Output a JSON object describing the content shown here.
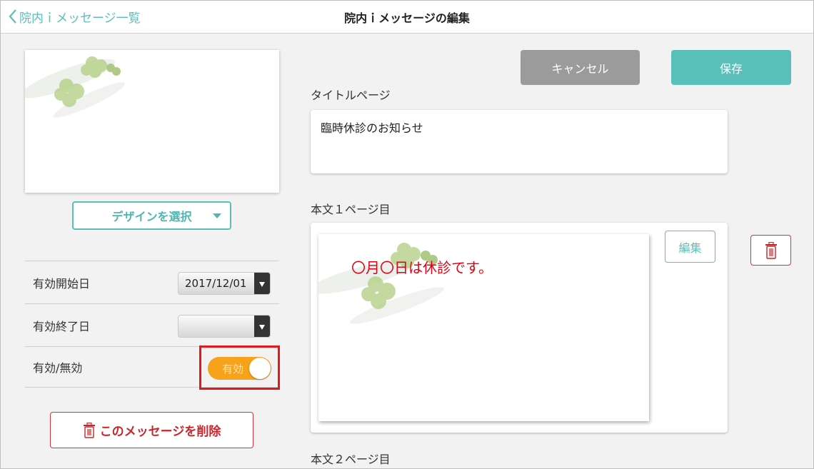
{
  "header": {
    "back_label": "院内ｉメッセージ一覧",
    "title": "院内ｉメッセージの編集"
  },
  "left": {
    "design_select_label": "デザインを選択",
    "settings": [
      {
        "label": "有効開始日",
        "value": "2017/12/01"
      },
      {
        "label": "有効終了日",
        "value": ""
      },
      {
        "label": "有効/無効",
        "toggle_text": "有効",
        "toggle_on": true
      }
    ],
    "delete_message_label": "このメッセージを削除"
  },
  "right": {
    "cancel_label": "キャンセル",
    "save_label": "保存",
    "title_page_label": "タイトルページ",
    "title_value": "臨時休診のお知らせ",
    "body_page1_label": "本文１ページ目",
    "body_page1_text": "〇月〇日は休診です。",
    "edit_label": "編集",
    "body_page2_label": "本文２ページ目"
  },
  "colors": {
    "accent": "#5bbfb9",
    "danger": "#d2343a",
    "toggle_on": "#f6a21b",
    "highlight": "#e6161e",
    "body_text": "#e60012"
  },
  "icons": {
    "back": "chevron-left-icon",
    "caret": "caret-down-icon",
    "date_picker": "caret-down-icon",
    "trash": "trash-icon",
    "decoration": "clover-icon"
  }
}
